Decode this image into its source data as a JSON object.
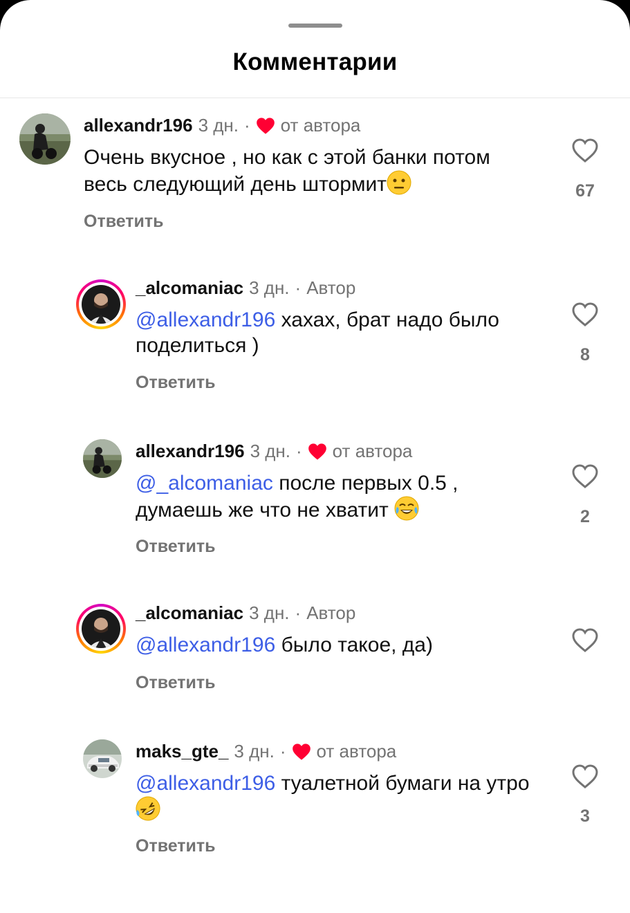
{
  "sheet": {
    "title": "Комментарии"
  },
  "comments": [
    {
      "user": "allexandr196",
      "time": "3 дн.",
      "dot": "·",
      "tag": "от автора",
      "liked_by_author": true,
      "mention": "",
      "text": "Очень вкусное , но как с этой банки потом весь следующий день штормит",
      "emoji": "neutral-face",
      "reply": "Ответить",
      "likes": "67"
    },
    {
      "user": "_alcomaniac",
      "time": "3 дн.",
      "dot": "·",
      "tag": "Автор",
      "liked_by_author": false,
      "mention": "@allexandr196",
      "text": " хахах, брат надо было поделиться )",
      "reply": "Ответить",
      "likes": "8"
    },
    {
      "user": "allexandr196",
      "time": "3 дн.",
      "dot": "·",
      "tag": "от автора",
      "liked_by_author": true,
      "mention": "@_alcomaniac",
      "text": " после первых 0.5 , думаешь же что не хватит ",
      "emoji": "tears-of-joy",
      "reply": "Ответить",
      "likes": "2"
    },
    {
      "user": "_alcomaniac",
      "time": "3 дн.",
      "dot": "·",
      "tag": "Автор",
      "liked_by_author": false,
      "mention": "@allexandr196",
      "text": " было такое, да)",
      "reply": "Ответить",
      "likes": ""
    },
    {
      "user": "maks_gte_",
      "time": "3 дн.",
      "dot": "·",
      "tag": "от автора",
      "liked_by_author": true,
      "mention": "@allexandr196",
      "text": " туалетной бумаги на утро ",
      "emoji": "rofl",
      "reply": "Ответить",
      "likes": "3"
    }
  ],
  "colors": {
    "heart_red": "#ff0033",
    "mention_blue": "#3d5ee6",
    "muted_gray": "#737373"
  }
}
